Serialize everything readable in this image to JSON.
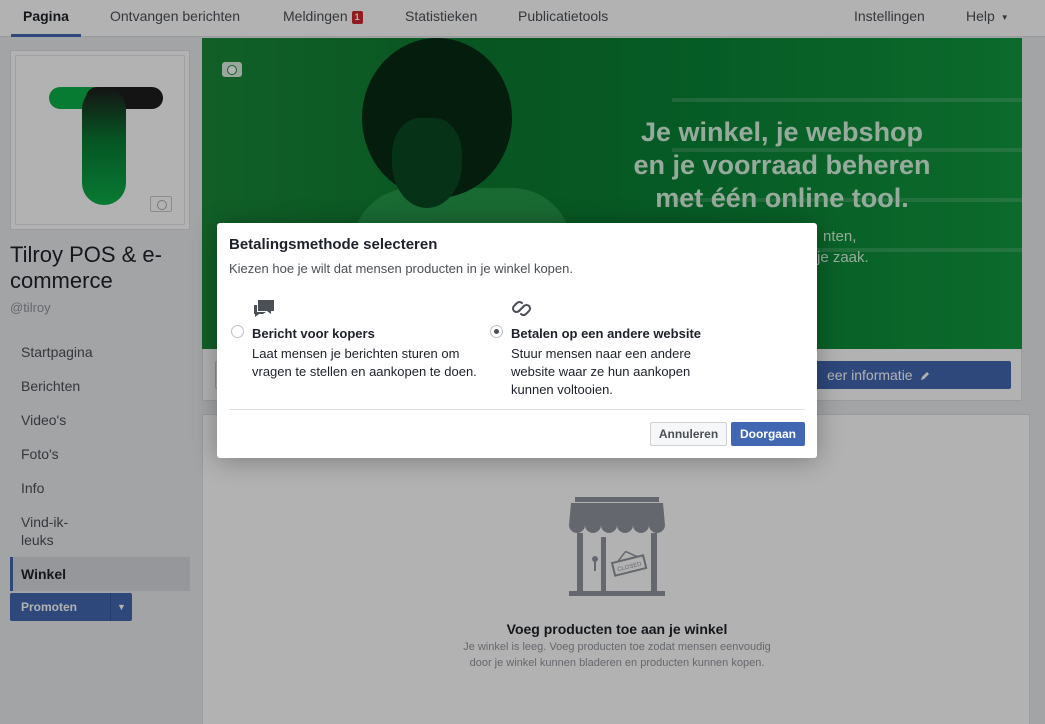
{
  "topnav": {
    "tabs": [
      {
        "label": "Pagina"
      },
      {
        "label": "Ontvangen berichten"
      },
      {
        "label": "Meldingen",
        "badge": "1"
      },
      {
        "label": "Statistieken"
      },
      {
        "label": "Publicatietools"
      }
    ],
    "settings": "Instellingen",
    "help": "Help"
  },
  "page": {
    "name": "Tilroy POS & e-commerce",
    "handle": "@tilroy"
  },
  "leftnav": {
    "items": [
      "Startpagina",
      "Berichten",
      "Video's",
      "Foto's",
      "Info",
      "Vind-ik-leuks",
      "Winkel"
    ],
    "selected": "Winkel"
  },
  "promote": {
    "label": "Promoten"
  },
  "cover": {
    "headline_lines": [
      "Je winkel, je webshop",
      "en je voorraad beheren",
      "met één online tool."
    ],
    "sub_lines": [
      "nten,",
      "je zaak."
    ]
  },
  "action_bar": {
    "more_info_label": "eer informatie"
  },
  "shop": {
    "title": "Voeg producten toe aan je winkel",
    "description": "Je winkel is leeg. Voeg producten toe zodat mensen eenvoudig door je winkel kunnen bladeren en producten kunnen kopen.",
    "sign_text": "CLOSED"
  },
  "dialog": {
    "title": "Betalingsmethode selecteren",
    "subtitle": "Kiezen hoe je wilt dat mensen producten in je winkel kopen.",
    "options": [
      {
        "icon": "chat-bubbles-icon",
        "title": "Bericht voor kopers",
        "description": "Laat mensen je berichten sturen om vragen te stellen en aankopen te doen.",
        "selected": false
      },
      {
        "icon": "link-icon",
        "title": "Betalen op een andere website",
        "description": "Stuur mensen naar een andere website waar ze hun aankopen kunnen voltooien.",
        "selected": true
      }
    ],
    "cancel_label": "Annuleren",
    "continue_label": "Doorgaan"
  },
  "colors": {
    "brand_blue": "#4267b2",
    "cover_green": "#0c7a30",
    "logo_green": "#0cb04a",
    "badge_red": "#d0282b"
  }
}
